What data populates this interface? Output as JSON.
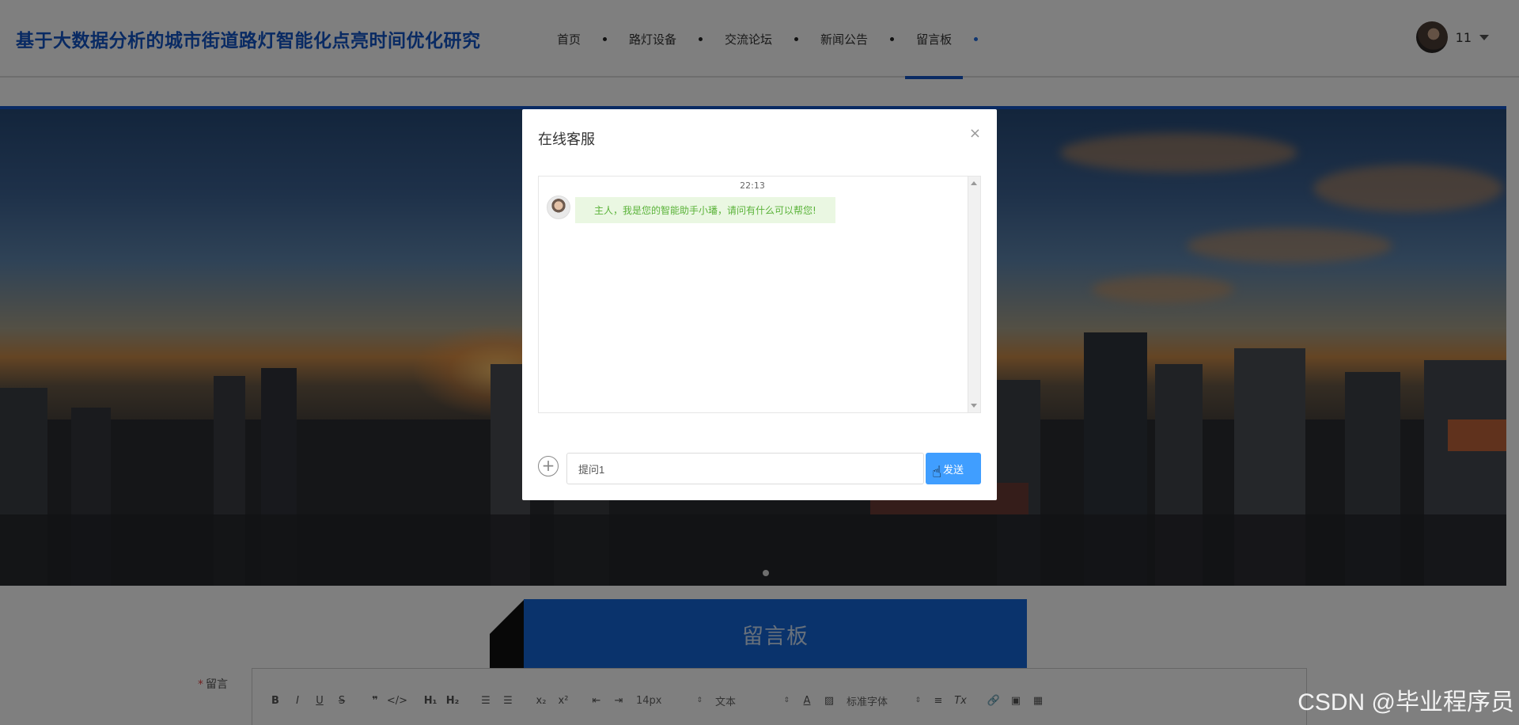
{
  "header": {
    "site_title": "基于大数据分析的城市街道路灯智能化点亮时间优化研究",
    "nav": [
      {
        "label": "首页",
        "active": false
      },
      {
        "label": "路灯设备",
        "active": false
      },
      {
        "label": "交流论坛",
        "active": false
      },
      {
        "label": "新闻公告",
        "active": false
      },
      {
        "label": "留言板",
        "active": true
      }
    ],
    "user_name": "11"
  },
  "section": {
    "title": "留言板"
  },
  "form": {
    "label": "留言",
    "toolbar": {
      "font_size": "14px",
      "text_type": "文本",
      "font_family": "标准字体"
    }
  },
  "modal": {
    "title": "在线客服",
    "close_symbol": "×",
    "messages": [
      {
        "time": "22:13",
        "text": "主人，我是您的智能助手小璠，请问有什么可以帮您!"
      }
    ],
    "input_value": "提问1",
    "send_label": "发送"
  },
  "watermark": "CSDN @毕业程序员",
  "colors": {
    "brand": "#1255c6",
    "section": "#1567d8",
    "send": "#409eff",
    "bubble_text": "#5bb33a"
  }
}
